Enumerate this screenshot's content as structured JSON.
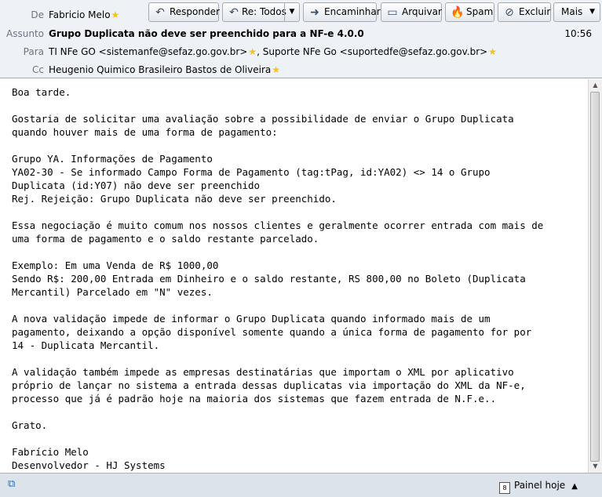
{
  "header": {
    "from": {
      "label": "De",
      "value": "Fabricio Melo"
    },
    "subject": {
      "label": "Assunto",
      "value": "Grupo Duplicata não deve ser preenchido para a NF-e 4.0.0"
    },
    "time": "10:56",
    "to": {
      "label": "Para",
      "recipient1": "TI NFe GO <sistemanfe@sefaz.go.gov.br>",
      "separator": ",",
      "recipient2": "Suporte NFe Go <suportedfe@sefaz.go.gov.br>"
    },
    "cc": {
      "label": "Cc",
      "value": "Heugenio Quimico Brasileiro Bastos de Oliveira"
    }
  },
  "toolbar": {
    "reply": "Responder",
    "reply_all": "Re: Todos",
    "forward": "Encaminhar",
    "archive": "Arquivar",
    "spam": "Spam",
    "delete": "Excluir",
    "more": "Mais"
  },
  "icons": {
    "star": "star-icon",
    "reply": "reply-icon",
    "reply_all": "reply-all-icon",
    "forward": "forward-icon",
    "archive": "archive-icon",
    "spam": "spam-icon",
    "delete": "delete-icon",
    "dropdown": "chevron-down-icon",
    "calendar": "calendar-icon",
    "chevron_up": "chevron-up-icon",
    "status": "connection-icon"
  },
  "message": {
    "body": "Boa tarde.\n\nGostaria de solicitar uma avaliação sobre a possibilidade de enviar o Grupo Duplicata\nquando houver mais de uma forma de pagamento:\n\nGrupo YA. Informações de Pagamento\nYA02-30 - Se informado Campo Forma de Pagamento (tag:tPag, id:YA02) <> 14 o Grupo\nDuplicata (id:Y07) não deve ser preenchido\nRej. Rejeição: Grupo Duplicata não deve ser preenchido.\n\nEssa negociação é muito comum nos nossos clientes e geralmente ocorrer entrada com mais de\numa forma de pagamento e o saldo restante parcelado.\n\nExemplo: Em uma Venda de R$ 1000,00\nSendo R$: 200,00 Entrada em Dinheiro e o saldo restante, RS 800,00 no Boleto (Duplicata\nMercantil) Parcelado em \"N\" vezes.\n\nA nova validação impede de informar o Grupo Duplicata quando informado mais de um\npagamento, deixando a opção disponível somente quando a única forma de pagamento for por\n14 - Duplicata Mercantil.\n\nA validação também impede as empresas destinatárias que importam o XML por aplicativo\npróprio de lançar no sistema a entrada dessas duplicatas via importação do XML da NF-e,\nprocesso que já é padrão hoje na maioria dos sistemas que fazem entrada de N.F.e..\n\nGrato.\n\nFabrício Melo\nDesenvolvedor - HJ Systems"
  },
  "statusbar": {
    "today_pane": "Painel hoje",
    "calendar_day": "8"
  },
  "colors": {
    "header_bg": "#eef2f7",
    "label": "#6d7580",
    "star": "#f5c21b",
    "statusbar_bg": "#dde3ea"
  }
}
